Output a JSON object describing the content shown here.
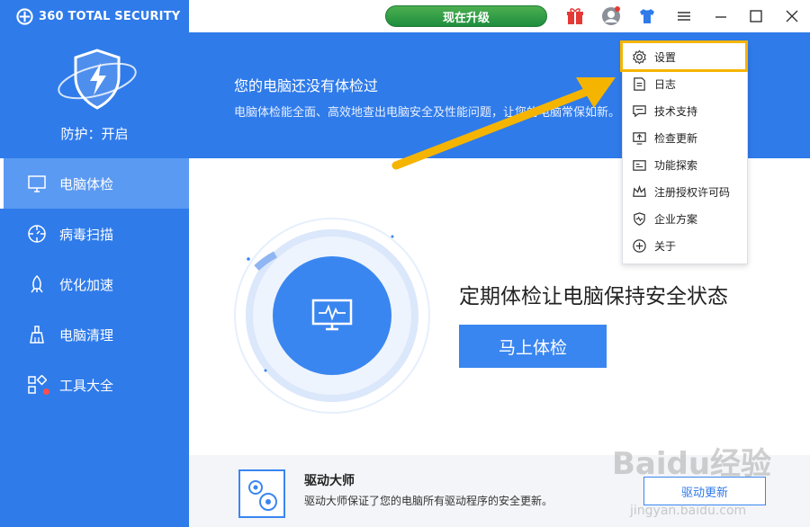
{
  "app": {
    "title": "360 TOTAL SECURITY"
  },
  "sidebar": {
    "protection_status": "防护：开启",
    "items": [
      {
        "label": "电脑体检",
        "icon": "monitor-icon",
        "active": true
      },
      {
        "label": "病毒扫描",
        "icon": "scan-icon",
        "active": false
      },
      {
        "label": "优化加速",
        "icon": "rocket-icon",
        "active": false
      },
      {
        "label": "电脑清理",
        "icon": "broom-icon",
        "active": false
      },
      {
        "label": "工具大全",
        "icon": "tools-grid-icon",
        "active": false
      }
    ]
  },
  "topbar": {
    "upgrade_label": "现在升级",
    "icons": [
      "gift-icon",
      "user-avatar-icon",
      "skin-shirt-icon",
      "menu-icon",
      "minimize-icon",
      "maximize-icon",
      "close-icon"
    ]
  },
  "banner": {
    "title": "您的电脑还没有体检过",
    "subtitle": "电脑体检能全面、高效地查出电脑安全及性能问题，让您的电脑常保如新。"
  },
  "main": {
    "headline": "定期体检让电脑保持安全状态",
    "check_button": "马上体检"
  },
  "bottom_card": {
    "title": "驱动大师",
    "description": "驱动大师保证了您的电脑所有驱动程序的安全更新。",
    "button": "驱动更新"
  },
  "dropdown_menu": {
    "items": [
      {
        "label": "设置",
        "icon": "gear-icon",
        "highlighted": true
      },
      {
        "label": "日志",
        "icon": "log-icon",
        "highlighted": false
      },
      {
        "label": "技术支持",
        "icon": "support-chat-icon",
        "highlighted": false
      },
      {
        "label": "检查更新",
        "icon": "update-icon",
        "highlighted": false
      },
      {
        "label": "功能探索",
        "icon": "explore-icon",
        "highlighted": false
      },
      {
        "label": "注册授权许可码",
        "icon": "crown-icon",
        "highlighted": false
      },
      {
        "label": "企业方案",
        "icon": "enterprise-shield-icon",
        "highlighted": false
      },
      {
        "label": "关于",
        "icon": "about-icon",
        "highlighted": false
      }
    ]
  },
  "annotation": {
    "highlight_color": "#f5b400"
  },
  "watermark": {
    "line1": "Baidu经验",
    "line2": "jingyan.baidu.com"
  },
  "colors": {
    "brand_blue": "#2f7bea",
    "active_nav": "#5b9af2",
    "upgrade_green": "#2e9e44"
  }
}
